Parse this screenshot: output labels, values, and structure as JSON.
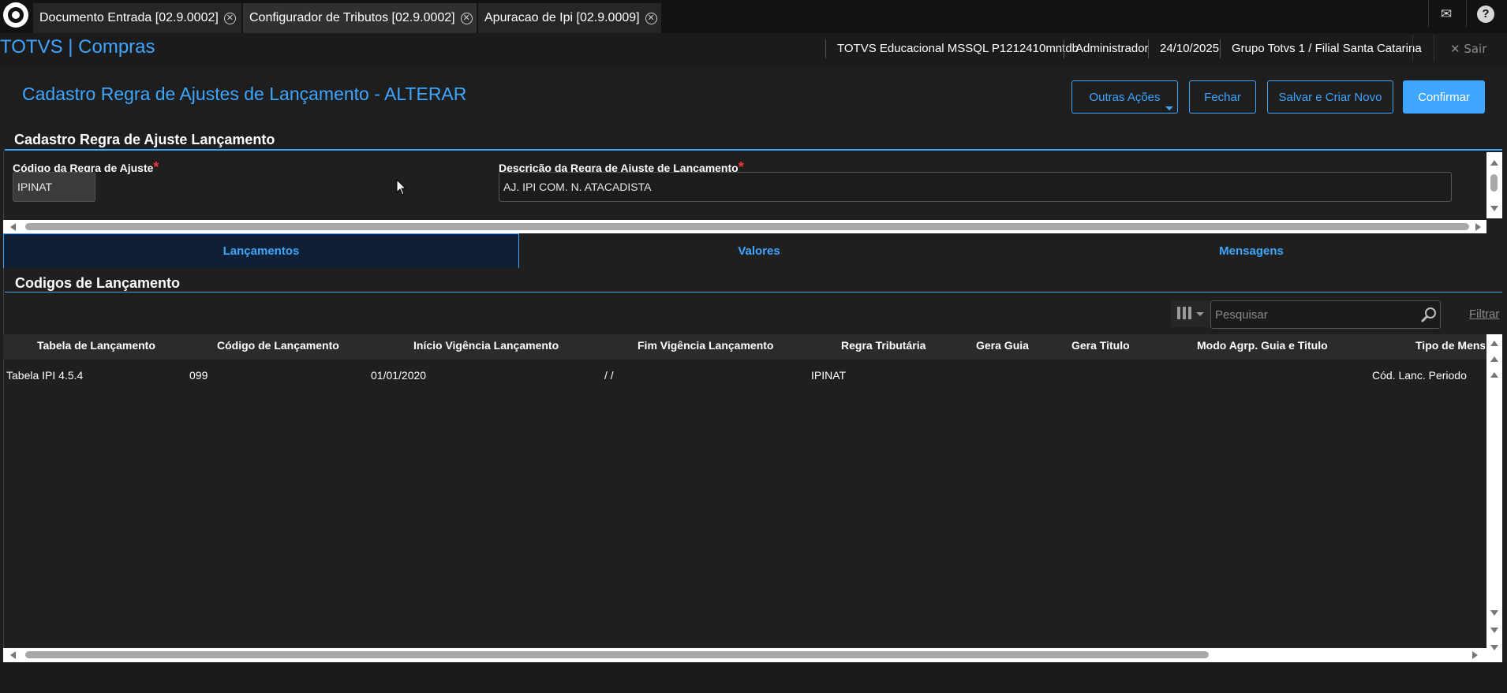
{
  "tabs": [
    {
      "label": "Documento Entrada [02.9.0002]",
      "active": false
    },
    {
      "label": "Configurador de Tributos [02.9.0002]",
      "active": true
    },
    {
      "label": "Apuracao de Ipi [02.9.0009]",
      "active": false
    }
  ],
  "header": {
    "app_title": "TOTVS | Compras",
    "environment": "TOTVS Educacional MSSQL P1212410mntdb",
    "user": "Administrador",
    "date": "24/10/2025",
    "company": "Grupo Totvs 1 / Filial Santa Catarina",
    "exit_label": "✕ Sair"
  },
  "page": {
    "title": "Cadastro Regra de Ajustes de Lançamento - ALTERAR",
    "buttons": {
      "other_actions": "Outras Ações",
      "close": "Fechar",
      "save_new": "Salvar e Criar Novo",
      "confirm": "Confirmar"
    }
  },
  "form": {
    "section_title": "Cadastro Regra de Ajuste Lançamento",
    "code_label": "Código da Regra de Ajuste",
    "code_value": "IPINAT",
    "desc_label": "Descrição da Regra de Ajuste de Lançamento",
    "desc_value": "AJ. IPI COM. N. ATACADISTA",
    "required_mark": "*"
  },
  "inner_tabs": [
    {
      "label": "Lançamentos",
      "active": true
    },
    {
      "label": "Valores",
      "active": false
    },
    {
      "label": "Mensagens",
      "active": false
    }
  ],
  "grid": {
    "section_title": "Codigos de Lançamento",
    "search_placeholder": "Pesquisar",
    "filter_label": "Filtrar",
    "columns": [
      "Tabela de Lançamento",
      "Código de Lançamento",
      "Início Vigência Lançamento",
      "Fim Vigência Lançamento",
      "Regra Tributária",
      "Gera Guia",
      "Gera Titulo",
      "Modo Agrp. Guia e Titulo",
      "Tipo de Mens"
    ],
    "rows": [
      {
        "tabela": "Tabela IPI 4.5.4",
        "codigo": "099",
        "inicio": "01/01/2020",
        "fim": "/ /",
        "regra": "IPINAT",
        "gera_guia": "",
        "gera_titulo": "",
        "modo": "",
        "tipo": "Cód. Lanc. Periodo"
      }
    ]
  },
  "icons": {
    "mail": "mail-icon",
    "help": "help-icon",
    "search": "search-icon",
    "columns": "columns-icon",
    "close": "close-icon"
  },
  "colors": {
    "accent": "#3ea6ff",
    "background": "#1e1e1e",
    "required": "#ff3333"
  }
}
